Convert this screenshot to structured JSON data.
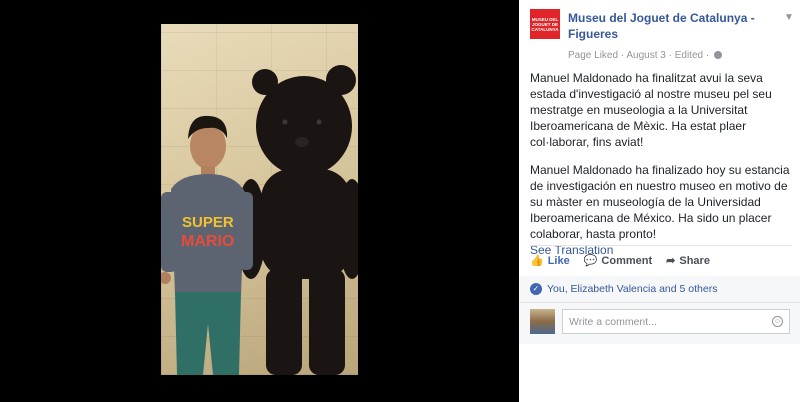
{
  "post": {
    "page_name": "Museu del Joguet de Catalunya - Figueres",
    "logo_text": "MUSEU DEL JOGUET DE CATALUNYA",
    "meta": "Page Liked · August 3 · Edited ·",
    "text_catalan": "Manuel Maldonado ha finalitzat avui la seva estada d'investigació al nostre museu pel seu mestratge en museologia a la Universitat Iberoamericana de Mèxic. Ha estat plaer col·laborar, fins aviat!",
    "text_spanish": "Manuel Maldonado ha finalizado hoy su estancia de investigación en nuestro museo en motivo de su màster en museología de la Universidad Iberoamericana de México. Ha sido un placer colaborar, hasta pronto!",
    "see_translation": "See Translation",
    "shirt_text": "SUPER MARIO"
  },
  "actions": {
    "like": "Like",
    "comment": "Comment",
    "share": "Share"
  },
  "reactions": {
    "text": "You, Elizabeth Valencia and 5 others"
  },
  "comment": {
    "placeholder": "Write a comment..."
  },
  "icons": {
    "like": "thumbs-up-icon",
    "comment": "speech-bubble-icon",
    "share": "share-arrow-icon",
    "emoji": "smiley-icon",
    "globe": "globe-icon",
    "chevron": "chevron-down-icon"
  },
  "colors": {
    "link": "#365899",
    "like_blue": "#4267b2",
    "logo_red": "#e0252a"
  }
}
